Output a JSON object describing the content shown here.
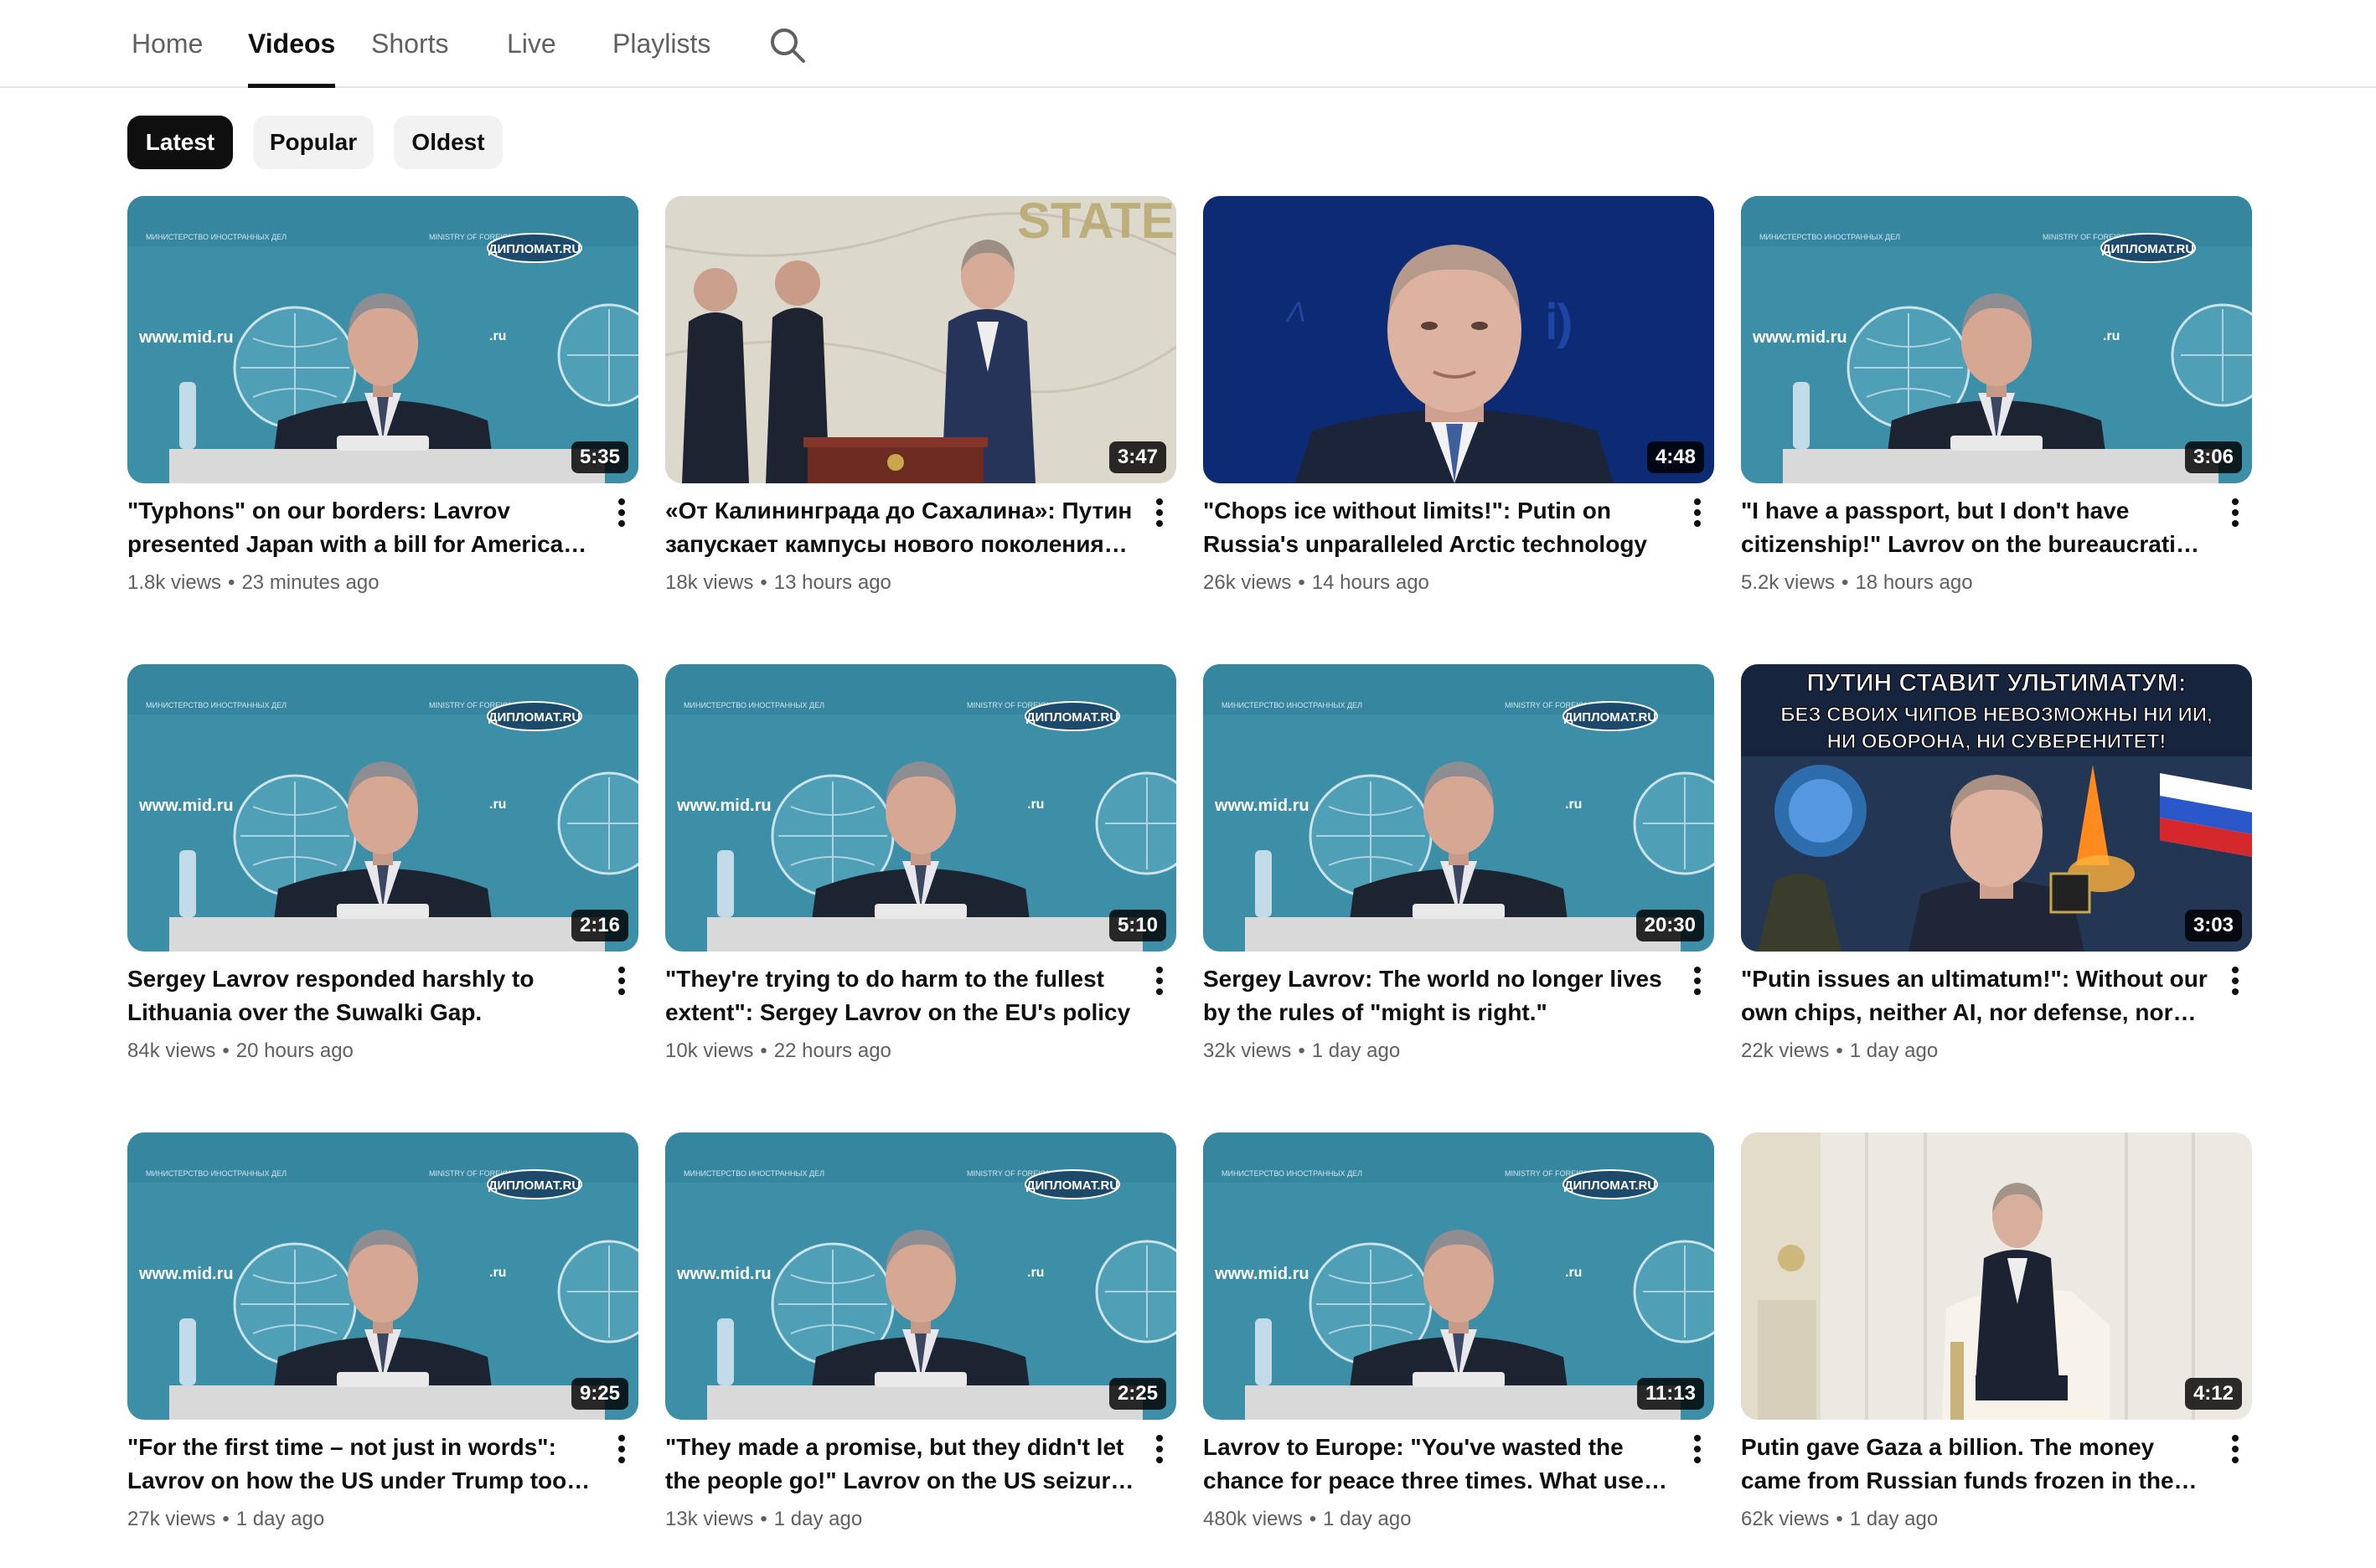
{
  "nav": {
    "tabs": [
      "Home",
      "Videos",
      "Shorts",
      "Live",
      "Playlists"
    ],
    "active_tab": "Videos",
    "search_icon": "search-icon"
  },
  "filters": {
    "chips": [
      "Latest",
      "Popular",
      "Oldest"
    ],
    "active": "Latest"
  },
  "videos": [
    {
      "title": "\"Typhons\" on our borders: Lavrov presented Japan with a bill for American missiles",
      "views": "1.8k views",
      "age": "23 minutes ago",
      "duration": "5:35",
      "scene": "lavrov"
    },
    {
      "title": "«От Калининграда до Сахалина»: Путин запускает кампусы нового поколения для будущих инженеров",
      "views": "18k views",
      "age": "13 hours ago",
      "duration": "3:47",
      "scene": "podium"
    },
    {
      "title": "\"Chops ice without limits!\": Putin on Russia's unparalleled Arctic technology",
      "views": "26k views",
      "age": "14 hours ago",
      "duration": "4:48",
      "scene": "closeup"
    },
    {
      "title": "\"I have a passport, but I don't have citizenship!\" Lavrov on the bureaucratic absurdity",
      "views": "5.2k views",
      "age": "18 hours ago",
      "duration": "3:06",
      "scene": "lavrov"
    },
    {
      "title": "Sergey Lavrov responded harshly to Lithuania over the Suwalki Gap.",
      "views": "84k views",
      "age": "20 hours ago",
      "duration": "2:16",
      "scene": "lavrov"
    },
    {
      "title": "\"They're trying to do harm to the fullest extent\": Sergey Lavrov on the EU's policy",
      "views": "10k views",
      "age": "22 hours ago",
      "duration": "5:10",
      "scene": "lavrov"
    },
    {
      "title": "Sergey Lavrov: The world no longer lives by the rules of \"might is right.\"",
      "views": "32k views",
      "age": "1 day ago",
      "duration": "20:30",
      "scene": "lavrov"
    },
    {
      "title": "\"Putin issues an ultimatum!\": Without our own chips, neither AI, nor defense, nor sovereignty!",
      "views": "22k views",
      "age": "1 day ago",
      "duration": "3:03",
      "scene": "poster",
      "poster_text": [
        "ПУТИН СТАВИТ УЛЬТИМАТУМ:",
        "БЕЗ СВОИХ ЧИПОВ НЕВОЗМОЖНЫ НИ ИИ,",
        "НИ ОБОРОНА, НИ СУВЕРЕНИТЕТ!"
      ]
    },
    {
      "title": "\"For the first time – not just in words\": Lavrov on how the US under Trump took Russia's position",
      "views": "27k views",
      "age": "1 day ago",
      "duration": "9:25",
      "scene": "lavrov"
    },
    {
      "title": "\"They made a promise, but they didn't let the people go!\" Lavrov on the US seizure of a tanker",
      "views": "13k views",
      "age": "1 day ago",
      "duration": "2:25",
      "scene": "lavrov"
    },
    {
      "title": "Lavrov to Europe: \"You've wasted the chance for peace three times. What use are you now?\"",
      "views": "480k views",
      "age": "1 day ago",
      "duration": "11:13",
      "scene": "lavrov"
    },
    {
      "title": "Putin gave Gaza a billion. The money came from Russian funds frozen in the US.",
      "views": "62k views",
      "age": "1 day ago",
      "duration": "4:12",
      "scene": "armchair"
    }
  ],
  "thumb_text": {
    "site": "www.mid.ru",
    "site_short": ".ru",
    "badge": "ДИПЛОМАТ.RU"
  },
  "colors": {
    "backdrop_teal": "#3b8da6",
    "chip_active": "#0f0f0f",
    "chip_bg": "#f2f2f2",
    "meta_text": "#606060"
  }
}
